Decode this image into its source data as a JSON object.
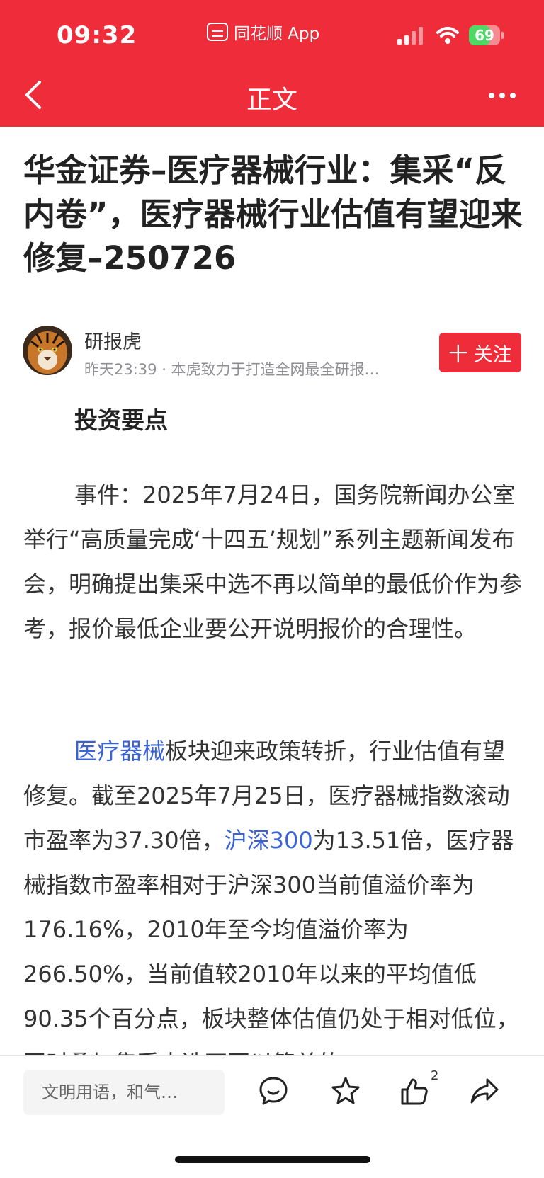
{
  "status_bar": {
    "time": "09:32",
    "app_name": "同花顺 App",
    "battery_level": "69",
    "battery_fraction": 0.69
  },
  "nav": {
    "title": "正文"
  },
  "article": {
    "title": "华金证券–医疗器械行业：集采“反内卷”，医疗器械行业估值有望迎来修复–250726",
    "author": {
      "name": "研报虎",
      "meta": "昨天23:39 · 本虎致力于打造全网最全研报…"
    },
    "follow_label": "十 关注",
    "section_heading": "投资要点",
    "para1": "事件：2025年7月24日，国务院新闻办公室举行“高质量完成‘十四五’规划”系列主题新闻发布会，明确提出集采中选不再以简单的最低价作为参考，报价最低企业要公开说明报价的合理性。",
    "para2_link1": "医疗器械",
    "para2_part1": "板块迎来政策转折，行业估值有望修复。截至2025年7月25日，医疗器械指数滚动市盈率为37.30倍，",
    "para2_link2": "沪深300",
    "para2_part2": "为13.51倍，医疗器械指数市盈率相对于沪深300当前值溢价率为176.16%，2010年至今均值溢价率为266.50%，当前值较2010年以来的平均值低90.35个百分点，板块整体估值仍处于相对低位，同时叠加集采中选不再以简单的"
  },
  "bottom_bar": {
    "comment_placeholder": "文明用语，和气…",
    "like_count": "2"
  },
  "icons": [
    "back-icon",
    "more-icon",
    "comment-icon",
    "star-icon",
    "like-icon",
    "share-icon"
  ],
  "colors": {
    "brand_red": "#ef2c3a",
    "link_blue": "#3a62d7"
  }
}
